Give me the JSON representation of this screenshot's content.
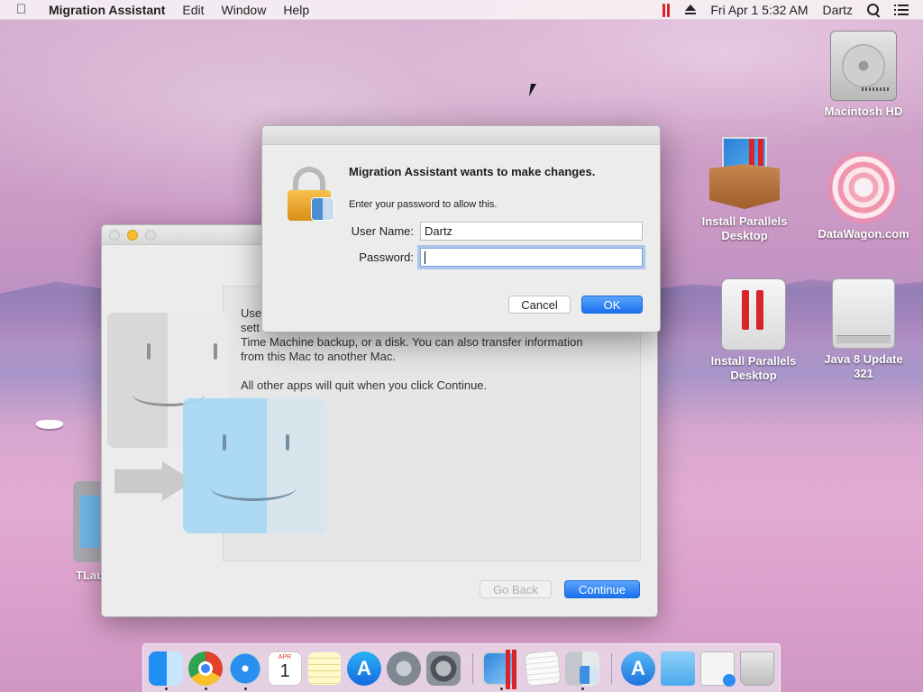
{
  "menubar": {
    "apple_symbol": "",
    "app_name": "Migration Assistant",
    "menus": [
      "Edit",
      "Window",
      "Help"
    ],
    "datetime": "Fri Apr 1  5:32 AM",
    "user": "Dartz",
    "status_icons": [
      "parallels-icon",
      "eject-icon",
      "spotlight-search-icon",
      "notification-list-icon"
    ]
  },
  "desktop_icons": [
    {
      "name": "Macintosh HD",
      "icon": "hard-drive-icon"
    },
    {
      "name": "Install Parallels Desktop",
      "icon": "parallels-box-icon"
    },
    {
      "name": "DataWagon.com",
      "icon": "flower-image-icon"
    },
    {
      "name": "Install Parallels Desktop",
      "icon": "parallels-drive-icon"
    },
    {
      "name": "Java 8 Update 321",
      "icon": "external-drive-icon"
    },
    {
      "name": "TLau",
      "icon": "folder-icon"
    }
  ],
  "migration_window": {
    "text_lines": [
      "Use",
      "sett",
      "Time Machine backup, or a disk. You can also transfer information",
      "from this Mac to another Mac."
    ],
    "quit_notice": "All other apps will quit when you click Continue.",
    "go_back_label": "Go Back",
    "continue_label": "Continue"
  },
  "auth_dialog": {
    "title": "Migration Assistant wants to make changes.",
    "subtitle": "Enter your password to allow this.",
    "username_label": "User Name:",
    "username_value": "Dartz",
    "password_label": "Password:",
    "password_value": "",
    "cancel_label": "Cancel",
    "ok_label": "OK"
  },
  "dock": {
    "items": [
      {
        "icon": "finder-icon",
        "running": true
      },
      {
        "icon": "chrome-icon",
        "running": true
      },
      {
        "icon": "safari-icon",
        "running": true
      },
      {
        "icon": "calendar-icon",
        "running": false
      },
      {
        "icon": "notes-icon",
        "running": false
      },
      {
        "icon": "app-store-icon",
        "running": false
      },
      {
        "icon": "launchpad-icon",
        "running": false
      },
      {
        "icon": "system-preferences-icon",
        "running": false
      },
      {
        "icon": "parallels-desktop-icon",
        "running": true
      },
      {
        "icon": "textedit-icon",
        "running": false
      },
      {
        "icon": "migration-assistant-icon",
        "running": true
      },
      {
        "icon": "applications-folder-icon",
        "running": false
      },
      {
        "icon": "documents-folder-icon",
        "running": false
      },
      {
        "icon": "downloads-stack-icon",
        "running": false
      },
      {
        "icon": "trash-icon",
        "running": false
      }
    ],
    "calendar": {
      "month": "APR",
      "day": "1"
    }
  }
}
